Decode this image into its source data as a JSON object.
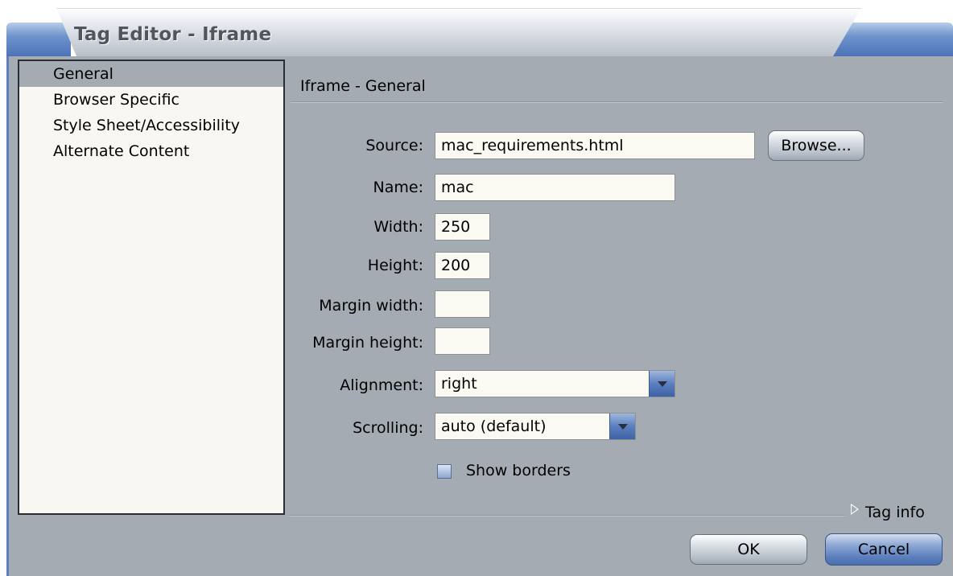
{
  "window": {
    "title": "Tag Editor - Iframe"
  },
  "sidebar": {
    "items": [
      {
        "label": "General",
        "selected": true
      },
      {
        "label": "Browser Specific",
        "selected": false
      },
      {
        "label": "Style Sheet/Accessibility",
        "selected": false
      },
      {
        "label": "Alternate Content",
        "selected": false
      }
    ]
  },
  "section": {
    "title": "Iframe - General"
  },
  "form": {
    "source_label": "Source:",
    "source_value": "mac_requirements.html",
    "browse_label": "Browse...",
    "name_label": "Name:",
    "name_value": "mac",
    "width_label": "Width:",
    "width_value": "250",
    "height_label": "Height:",
    "height_value": "200",
    "margin_width_label": "Margin width:",
    "margin_width_value": "",
    "margin_height_label": "Margin height:",
    "margin_height_value": "",
    "alignment_label": "Alignment:",
    "alignment_value": "right",
    "scrolling_label": "Scrolling:",
    "scrolling_value": "auto (default)",
    "show_borders_label": "Show borders",
    "show_borders_checked": false
  },
  "tag_info": {
    "label": "Tag info"
  },
  "buttons": {
    "ok": "OK",
    "cancel": "Cancel"
  },
  "colors": {
    "window_bg": "#a4abb3",
    "accent_blue": "#5b7fbd",
    "field_bg": "#fbfaf2"
  }
}
